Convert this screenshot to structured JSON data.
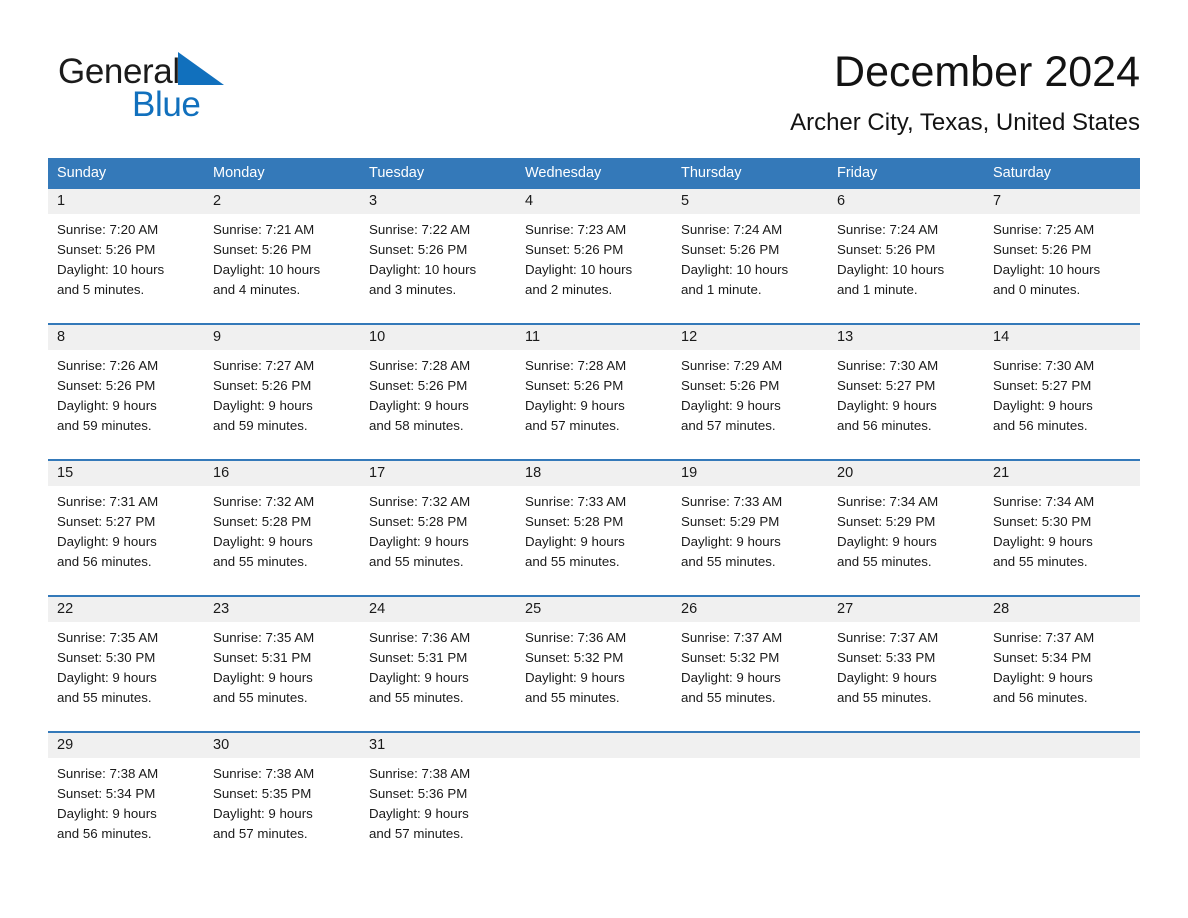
{
  "brand": {
    "name_part1": "General",
    "name_part2": "Blue",
    "flag_icon": "triangle-flag-icon",
    "accent_color": "#1170bd"
  },
  "header": {
    "month_title": "December 2024",
    "location": "Archer City, Texas, United States"
  },
  "calendar": {
    "header_bg_color": "#3479b9",
    "daynum_bg_color": "#f0f0f0",
    "weekdays": [
      "Sunday",
      "Monday",
      "Tuesday",
      "Wednesday",
      "Thursday",
      "Friday",
      "Saturday"
    ],
    "weeks": [
      [
        {
          "day": "1",
          "sunrise": "Sunrise: 7:20 AM",
          "sunset": "Sunset: 5:26 PM",
          "daylight_line1": "Daylight: 10 hours",
          "daylight_line2": "and 5 minutes."
        },
        {
          "day": "2",
          "sunrise": "Sunrise: 7:21 AM",
          "sunset": "Sunset: 5:26 PM",
          "daylight_line1": "Daylight: 10 hours",
          "daylight_line2": "and 4 minutes."
        },
        {
          "day": "3",
          "sunrise": "Sunrise: 7:22 AM",
          "sunset": "Sunset: 5:26 PM",
          "daylight_line1": "Daylight: 10 hours",
          "daylight_line2": "and 3 minutes."
        },
        {
          "day": "4",
          "sunrise": "Sunrise: 7:23 AM",
          "sunset": "Sunset: 5:26 PM",
          "daylight_line1": "Daylight: 10 hours",
          "daylight_line2": "and 2 minutes."
        },
        {
          "day": "5",
          "sunrise": "Sunrise: 7:24 AM",
          "sunset": "Sunset: 5:26 PM",
          "daylight_line1": "Daylight: 10 hours",
          "daylight_line2": "and 1 minute."
        },
        {
          "day": "6",
          "sunrise": "Sunrise: 7:24 AM",
          "sunset": "Sunset: 5:26 PM",
          "daylight_line1": "Daylight: 10 hours",
          "daylight_line2": "and 1 minute."
        },
        {
          "day": "7",
          "sunrise": "Sunrise: 7:25 AM",
          "sunset": "Sunset: 5:26 PM",
          "daylight_line1": "Daylight: 10 hours",
          "daylight_line2": "and 0 minutes."
        }
      ],
      [
        {
          "day": "8",
          "sunrise": "Sunrise: 7:26 AM",
          "sunset": "Sunset: 5:26 PM",
          "daylight_line1": "Daylight: 9 hours",
          "daylight_line2": "and 59 minutes."
        },
        {
          "day": "9",
          "sunrise": "Sunrise: 7:27 AM",
          "sunset": "Sunset: 5:26 PM",
          "daylight_line1": "Daylight: 9 hours",
          "daylight_line2": "and 59 minutes."
        },
        {
          "day": "10",
          "sunrise": "Sunrise: 7:28 AM",
          "sunset": "Sunset: 5:26 PM",
          "daylight_line1": "Daylight: 9 hours",
          "daylight_line2": "and 58 minutes."
        },
        {
          "day": "11",
          "sunrise": "Sunrise: 7:28 AM",
          "sunset": "Sunset: 5:26 PM",
          "daylight_line1": "Daylight: 9 hours",
          "daylight_line2": "and 57 minutes."
        },
        {
          "day": "12",
          "sunrise": "Sunrise: 7:29 AM",
          "sunset": "Sunset: 5:26 PM",
          "daylight_line1": "Daylight: 9 hours",
          "daylight_line2": "and 57 minutes."
        },
        {
          "day": "13",
          "sunrise": "Sunrise: 7:30 AM",
          "sunset": "Sunset: 5:27 PM",
          "daylight_line1": "Daylight: 9 hours",
          "daylight_line2": "and 56 minutes."
        },
        {
          "day": "14",
          "sunrise": "Sunrise: 7:30 AM",
          "sunset": "Sunset: 5:27 PM",
          "daylight_line1": "Daylight: 9 hours",
          "daylight_line2": "and 56 minutes."
        }
      ],
      [
        {
          "day": "15",
          "sunrise": "Sunrise: 7:31 AM",
          "sunset": "Sunset: 5:27 PM",
          "daylight_line1": "Daylight: 9 hours",
          "daylight_line2": "and 56 minutes."
        },
        {
          "day": "16",
          "sunrise": "Sunrise: 7:32 AM",
          "sunset": "Sunset: 5:28 PM",
          "daylight_line1": "Daylight: 9 hours",
          "daylight_line2": "and 55 minutes."
        },
        {
          "day": "17",
          "sunrise": "Sunrise: 7:32 AM",
          "sunset": "Sunset: 5:28 PM",
          "daylight_line1": "Daylight: 9 hours",
          "daylight_line2": "and 55 minutes."
        },
        {
          "day": "18",
          "sunrise": "Sunrise: 7:33 AM",
          "sunset": "Sunset: 5:28 PM",
          "daylight_line1": "Daylight: 9 hours",
          "daylight_line2": "and 55 minutes."
        },
        {
          "day": "19",
          "sunrise": "Sunrise: 7:33 AM",
          "sunset": "Sunset: 5:29 PM",
          "daylight_line1": "Daylight: 9 hours",
          "daylight_line2": "and 55 minutes."
        },
        {
          "day": "20",
          "sunrise": "Sunrise: 7:34 AM",
          "sunset": "Sunset: 5:29 PM",
          "daylight_line1": "Daylight: 9 hours",
          "daylight_line2": "and 55 minutes."
        },
        {
          "day": "21",
          "sunrise": "Sunrise: 7:34 AM",
          "sunset": "Sunset: 5:30 PM",
          "daylight_line1": "Daylight: 9 hours",
          "daylight_line2": "and 55 minutes."
        }
      ],
      [
        {
          "day": "22",
          "sunrise": "Sunrise: 7:35 AM",
          "sunset": "Sunset: 5:30 PM",
          "daylight_line1": "Daylight: 9 hours",
          "daylight_line2": "and 55 minutes."
        },
        {
          "day": "23",
          "sunrise": "Sunrise: 7:35 AM",
          "sunset": "Sunset: 5:31 PM",
          "daylight_line1": "Daylight: 9 hours",
          "daylight_line2": "and 55 minutes."
        },
        {
          "day": "24",
          "sunrise": "Sunrise: 7:36 AM",
          "sunset": "Sunset: 5:31 PM",
          "daylight_line1": "Daylight: 9 hours",
          "daylight_line2": "and 55 minutes."
        },
        {
          "day": "25",
          "sunrise": "Sunrise: 7:36 AM",
          "sunset": "Sunset: 5:32 PM",
          "daylight_line1": "Daylight: 9 hours",
          "daylight_line2": "and 55 minutes."
        },
        {
          "day": "26",
          "sunrise": "Sunrise: 7:37 AM",
          "sunset": "Sunset: 5:32 PM",
          "daylight_line1": "Daylight: 9 hours",
          "daylight_line2": "and 55 minutes."
        },
        {
          "day": "27",
          "sunrise": "Sunrise: 7:37 AM",
          "sunset": "Sunset: 5:33 PM",
          "daylight_line1": "Daylight: 9 hours",
          "daylight_line2": "and 55 minutes."
        },
        {
          "day": "28",
          "sunrise": "Sunrise: 7:37 AM",
          "sunset": "Sunset: 5:34 PM",
          "daylight_line1": "Daylight: 9 hours",
          "daylight_line2": "and 56 minutes."
        }
      ],
      [
        {
          "day": "29",
          "sunrise": "Sunrise: 7:38 AM",
          "sunset": "Sunset: 5:34 PM",
          "daylight_line1": "Daylight: 9 hours",
          "daylight_line2": "and 56 minutes."
        },
        {
          "day": "30",
          "sunrise": "Sunrise: 7:38 AM",
          "sunset": "Sunset: 5:35 PM",
          "daylight_line1": "Daylight: 9 hours",
          "daylight_line2": "and 57 minutes."
        },
        {
          "day": "31",
          "sunrise": "Sunrise: 7:38 AM",
          "sunset": "Sunset: 5:36 PM",
          "daylight_line1": "Daylight: 9 hours",
          "daylight_line2": "and 57 minutes."
        },
        {
          "day": "",
          "sunrise": "",
          "sunset": "",
          "daylight_line1": "",
          "daylight_line2": ""
        },
        {
          "day": "",
          "sunrise": "",
          "sunset": "",
          "daylight_line1": "",
          "daylight_line2": ""
        },
        {
          "day": "",
          "sunrise": "",
          "sunset": "",
          "daylight_line1": "",
          "daylight_line2": ""
        },
        {
          "day": "",
          "sunrise": "",
          "sunset": "",
          "daylight_line1": "",
          "daylight_line2": ""
        }
      ]
    ]
  }
}
